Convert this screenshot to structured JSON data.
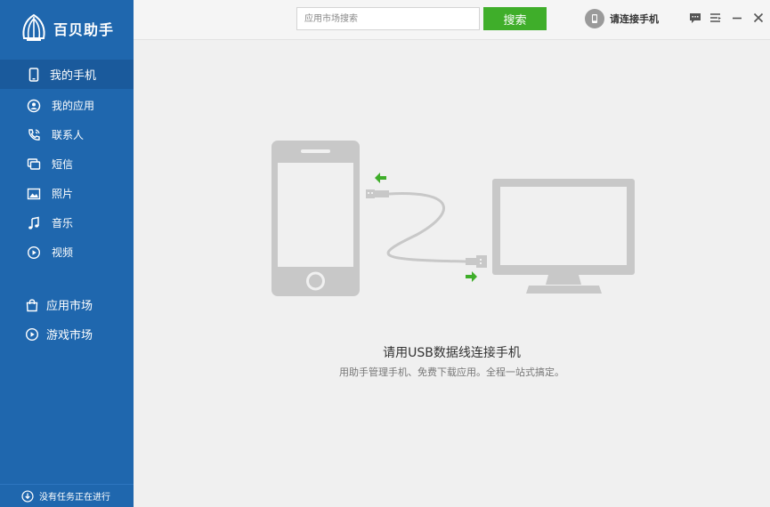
{
  "app": {
    "name": "百贝助手"
  },
  "sidebar": {
    "main_item": {
      "label": "我的手机",
      "icon": "phone-icon"
    },
    "sub_items": [
      {
        "label": "我的应用",
        "icon": "apps-icon"
      },
      {
        "label": "联系人",
        "icon": "contacts-icon"
      },
      {
        "label": "短信",
        "icon": "sms-icon"
      },
      {
        "label": "照片",
        "icon": "photo-icon"
      },
      {
        "label": "音乐",
        "icon": "music-icon"
      },
      {
        "label": "视频",
        "icon": "video-icon"
      }
    ],
    "markets": [
      {
        "label": "应用市场",
        "icon": "bag-icon"
      },
      {
        "label": "游戏市场",
        "icon": "play-icon"
      }
    ],
    "status": "没有任务正在进行"
  },
  "topbar": {
    "search_placeholder": "应用市场搜索",
    "search_button": "搜索",
    "connect_label": "请连接手机"
  },
  "main": {
    "title": "请用USB数据线连接手机",
    "subtitle": "用助手管理手机、免费下载应用。全程一站式搞定。"
  },
  "colors": {
    "sidebar": "#1f67ae",
    "sidebar_active": "#1a5a9c",
    "accent_green": "#3fae2a",
    "illustration_gray": "#c8c8c8"
  }
}
